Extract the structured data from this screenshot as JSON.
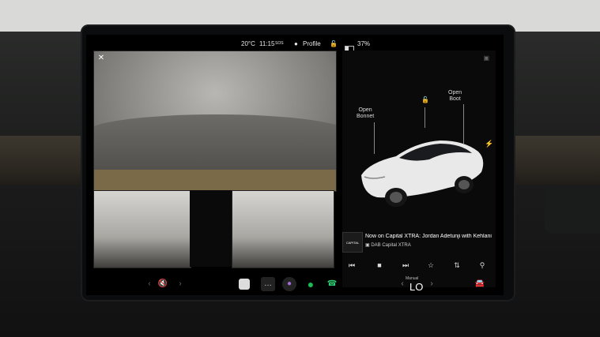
{
  "status_bar": {
    "temperature": "20°C",
    "time": "11:15",
    "sos_label": "SOS",
    "profile_label": "Profile",
    "battery_percent": "37%",
    "battery_level": 0.37
  },
  "vehicle_panel": {
    "open_bonnet": "Open\nBonnet",
    "open_boot": "Open\nBoot",
    "charge_icon": "lightning-icon"
  },
  "media": {
    "logo_text": "CAPITAL",
    "now_playing": "Now on Capital XTRA: Jordan Adetunji with Kehlani",
    "station": "DAB Capital XTRA",
    "controls": [
      "previous-icon",
      "stop-icon",
      "next-icon",
      "favorite-icon",
      "equalizer-icon",
      "search-icon"
    ]
  },
  "climate": {
    "mode": "Manual",
    "temp": "LO"
  },
  "colors": {
    "accent_green": "#1db954",
    "call_green": "#2ecc71",
    "screen_bg": "#000000"
  }
}
